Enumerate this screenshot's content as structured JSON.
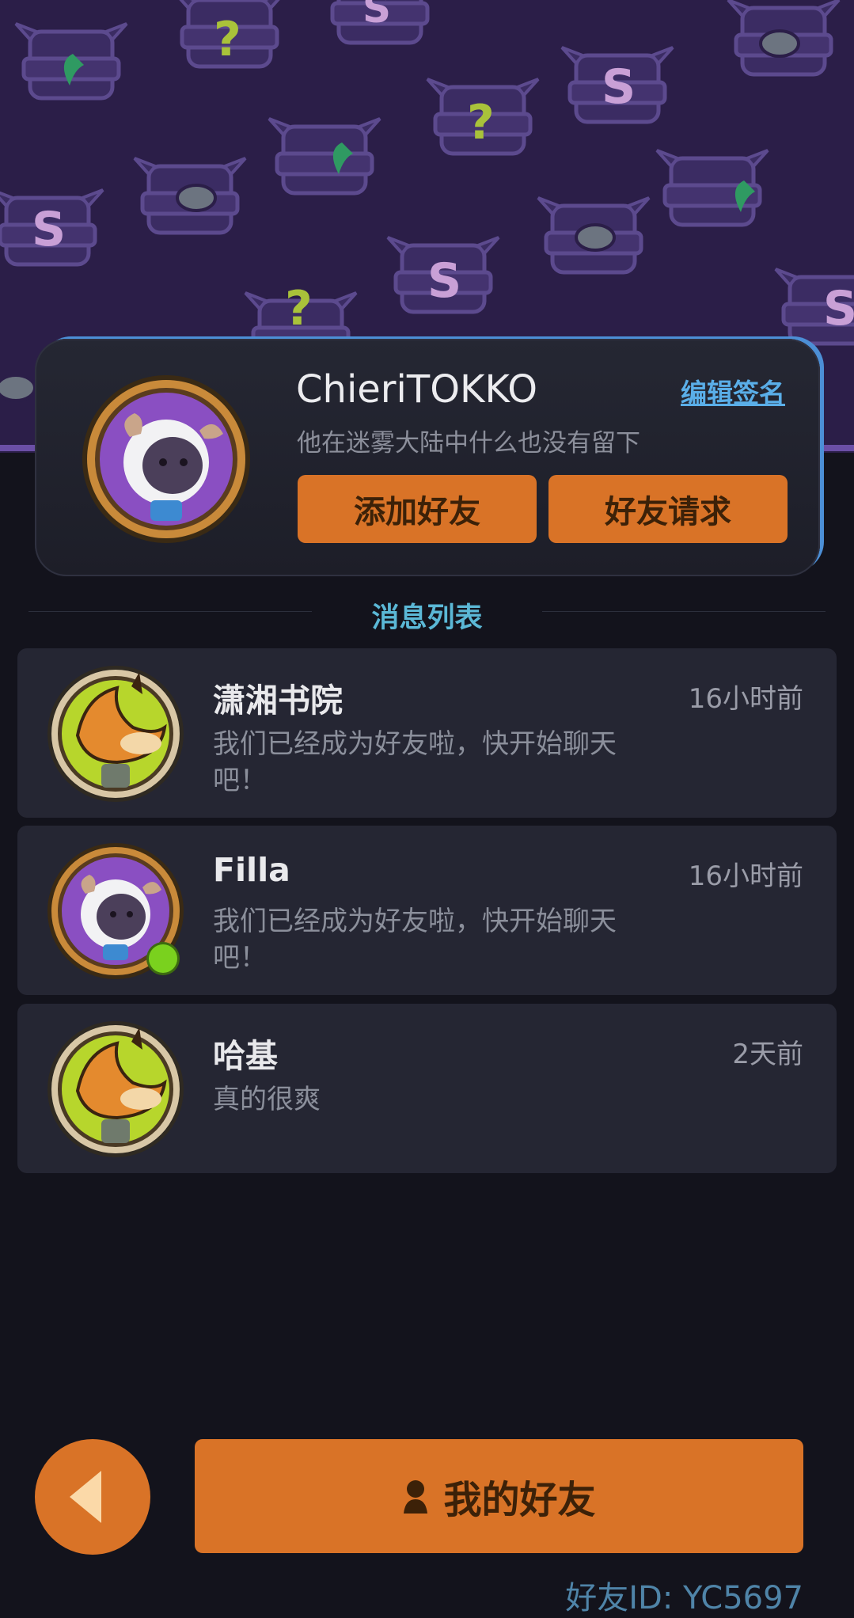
{
  "profile": {
    "username": "ChieriTOKKO",
    "edit_signature_label": "编辑签名",
    "signature": "他在迷雾大陆中什么也没有留下",
    "add_friend_label": "添加好友",
    "friend_request_label": "好友请求",
    "avatar": "sheep-avatar-icon"
  },
  "message_list": {
    "title": "消息列表",
    "items": [
      {
        "name": "潇湘书院",
        "time": "16小时前",
        "preview": "我们已经成为好友啦，快开始聊天吧！",
        "avatar": "fox-avatar-icon",
        "online": false
      },
      {
        "name": "Filla",
        "time": "16小时前",
        "preview": "我们已经成为好友啦，快开始聊天吧！",
        "avatar": "sheep-avatar-icon",
        "online": true
      },
      {
        "name": "哈基",
        "time": "2天前",
        "preview": "真的很爽",
        "avatar": "fox-avatar-icon",
        "online": false
      }
    ]
  },
  "bottom": {
    "my_friends_label": "我的好友",
    "friend_id": "好友ID: YC5697",
    "back_icon": "chevron-left-icon",
    "person_icon": "person-icon"
  },
  "colors": {
    "accent_orange": "#d97327",
    "banner_purple": "#2b1e48",
    "title_cyan": "#5bb8d6",
    "online_green": "#7ad11e"
  }
}
